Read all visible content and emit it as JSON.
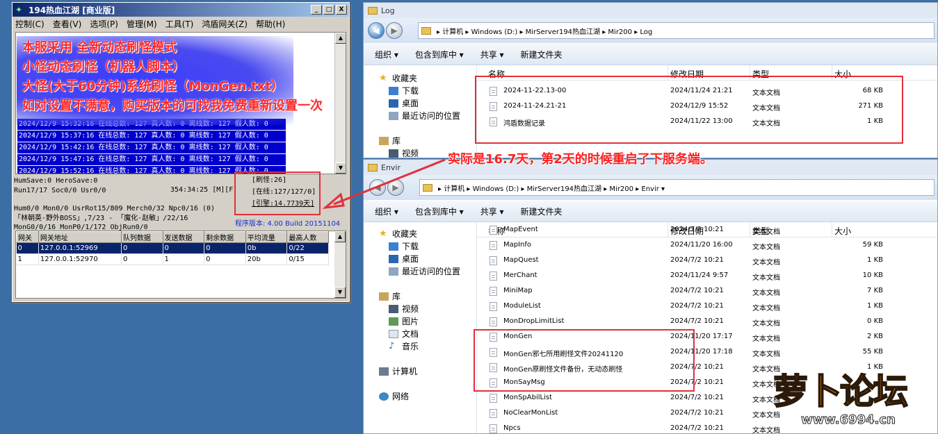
{
  "game_window": {
    "title": "194热血江湖 [商业版]",
    "buttons": [
      "_",
      "□",
      "X"
    ],
    "menu": [
      "控制(C)",
      "查看(V)",
      "选项(P)",
      "管理(M)",
      "工具(T)",
      "鸿盾网关(Z)",
      "帮助(H)"
    ],
    "overlay_lines": [
      "本服采用 全新动态刷怪模式",
      "小怪动态刷怪（机器人脚本）",
      "大怪(大于60分钟)系统刷怪（MonGen.txt）",
      "如对设置不满意，购买版本的可找我免费重新设置一次"
    ],
    "log_rows": [
      "2024/12/9 15:32:16 在线总数: 127 真人数: 0 离线数: 127 假人数: 0",
      "2024/12/9 15:37:16 在线总数: 127 真人数: 0 离线数: 127 假人数: 0",
      "2024/12/9 15:42:16 在线总数: 127 真人数: 0 离线数: 127 假人数: 0",
      "2024/12/9 15:47:16 在线总数: 127 真人数: 0 离线数: 127 假人数: 0",
      "2024/12/9 15:52:16 在线总数: 127 真人数: 0 离线数: 127 假人数: 0"
    ],
    "status_lines": [
      "HumSave:0 HeroSave:0",
      "Run17/17 Soc0/0 Usr0/0",
      "Hum0/0 Mon0/0 UsrRot15/809 Merch0/32 Npc0/16 (0)",
      "「林朝英·野外BOSS」,7/23 - 「魔化·赵敏」/22/16",
      "MonG0/0/16 MonP0/1/172 ObjRun0/0"
    ],
    "runtime": "354:34:25 [M][F]",
    "stat_box": {
      "refresh": "[刷怪:26]",
      "online": "[在线:127/127/0]",
      "engine": "[引擎:14.7739天]"
    },
    "version": "程序版本: 4.00 Build 20151104",
    "gate_table": {
      "headers": [
        "网关",
        "网关地址",
        "队列数据",
        "发送数据",
        "剩余数据",
        "平均流量",
        "最高人数"
      ],
      "rows": [
        [
          "0",
          "127.0.0.1:52969",
          "0",
          "0",
          "0",
          "0b",
          "0/22"
        ],
        [
          "1",
          "127.0.0.1:52970",
          "0",
          "1",
          "0",
          "20b",
          "0/15"
        ]
      ]
    }
  },
  "log_window": {
    "title": "Log",
    "breadcrumb": "▸ 计算机 ▸ Windows (D:) ▸ MirServer194热血江湖 ▸ Mir200 ▸ Log",
    "toolbar": [
      "组织 ▾",
      "包含到库中 ▾",
      "共享 ▾",
      "新建文件夹"
    ],
    "nav": [
      "收藏夹",
      "下载",
      "桌面",
      "最近访问的位置",
      "库",
      "视频"
    ],
    "columns": [
      "名称",
      "修改日期",
      "类型",
      "大小"
    ],
    "files": [
      {
        "name": "2024-11-22.13-00",
        "date": "2024/11/24 21:21",
        "type": "文本文档",
        "size": "68 KB"
      },
      {
        "name": "2024-11-24.21-21",
        "date": "2024/12/9 15:52",
        "type": "文本文档",
        "size": "271 KB"
      },
      {
        "name": "鸿盾数据记录",
        "date": "2024/11/22 13:00",
        "type": "文本文档",
        "size": "1 KB"
      }
    ]
  },
  "env_window": {
    "title": "Envir",
    "breadcrumb": "▸ 计算机 ▸ Windows (D:) ▸ MirServer194热血江湖 ▸ Mir200 ▸ Envir ▾",
    "toolbar": [
      "组织 ▾",
      "包含到库中 ▾",
      "共享 ▾",
      "新建文件夹"
    ],
    "nav": [
      "收藏夹",
      "下载",
      "桌面",
      "最近访问的位置",
      "库",
      "视频",
      "图片",
      "文档",
      "音乐",
      "计算机",
      "网络"
    ],
    "columns": [
      "名称",
      "修改日期",
      "类型",
      "大小"
    ],
    "files": [
      {
        "name": "MapEvent",
        "date": "2024/7/2 10:21",
        "type": "文本文档",
        "size": ""
      },
      {
        "name": "MapInfo",
        "date": "2024/11/20 16:00",
        "type": "文本文档",
        "size": "59 KB"
      },
      {
        "name": "MapQuest",
        "date": "2024/7/2 10:21",
        "type": "文本文档",
        "size": "1 KB"
      },
      {
        "name": "MerChant",
        "date": "2024/11/24 9:57",
        "type": "文本文档",
        "size": "10 KB"
      },
      {
        "name": "MiniMap",
        "date": "2024/7/2 10:21",
        "type": "文本文档",
        "size": "7 KB"
      },
      {
        "name": "ModuleList",
        "date": "2024/7/2 10:21",
        "type": "文本文档",
        "size": "1 KB"
      },
      {
        "name": "MonDropLimitList",
        "date": "2024/7/2 10:21",
        "type": "文本文档",
        "size": "0 KB"
      },
      {
        "name": "MonGen",
        "date": "2024/11/20 17:17",
        "type": "文本文档",
        "size": "2 KB"
      },
      {
        "name": "MonGen邪七所用刷怪文件20241120",
        "date": "2024/11/20 17:18",
        "type": "文本文档",
        "size": "55 KB"
      },
      {
        "name": "MonGen原刷怪文件备份，无动态刷怪",
        "date": "2024/7/2 10:21",
        "type": "文本文档",
        "size": "1 KB"
      },
      {
        "name": "MonSayMsg",
        "date": "2024/7/2 10:21",
        "type": "文本文档",
        "size": ""
      },
      {
        "name": "MonSpAbilList",
        "date": "2024/7/2 10:21",
        "type": "文本文档",
        "size": ""
      },
      {
        "name": "NoClearMonList",
        "date": "2024/7/2 10:21",
        "type": "文本文档",
        "size": ""
      },
      {
        "name": "Npcs",
        "date": "2024/7/2 10:21",
        "type": "文本文档",
        "size": ""
      }
    ]
  },
  "annotation": "实际是16.7天，第2天的时候重启了下服务端。",
  "watermark": {
    "text": "萝卜论坛",
    "url": "www.6994.cn"
  },
  "colors": {
    "desktop": "#3a6ea5",
    "annotation_red": "#ff2020",
    "log_blue": "#0000cc"
  }
}
